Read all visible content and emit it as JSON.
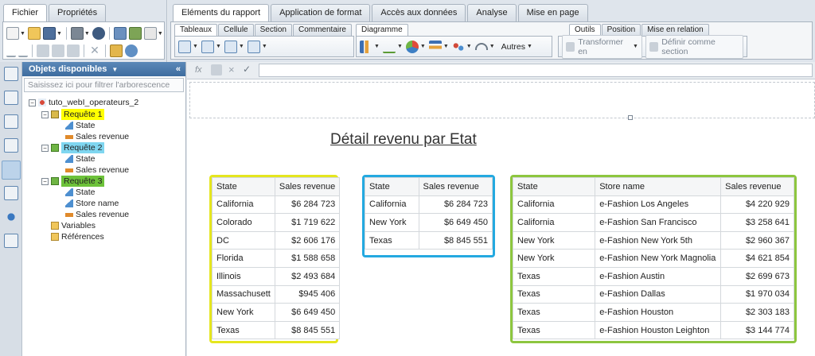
{
  "top_left_tabs": [
    "Fichier",
    "Propriétés"
  ],
  "ribbon_tabs": [
    "Eléments du rapport",
    "Application de format",
    "Accès aux données",
    "Analyse",
    "Mise en page"
  ],
  "ribbon": {
    "group1_tabs": [
      "Tableaux",
      "Cellule",
      "Section",
      "Commentaire"
    ],
    "group2_tabs": [
      "Diagramme"
    ],
    "group3_tabs": [
      "Outils",
      "Position",
      "Mise en relation"
    ],
    "autres_label": "Autres",
    "transformer_label": "Transformer en",
    "definir_label": "Définir comme section"
  },
  "objects_panel": {
    "title": "Objets disponibles",
    "filter_placeholder": "Saisissez ici pour filtrer l'arborescence",
    "root": "tuto_webI_operateurs_2",
    "query1": {
      "label": "Requête 1",
      "color": "#ffff00",
      "items": [
        "State",
        "Sales revenue"
      ]
    },
    "query2": {
      "label": "Requête 2",
      "color": "#7fd6f0",
      "items": [
        "State",
        "Sales revenue"
      ]
    },
    "query3": {
      "label": "Requête 3",
      "color": "#6dc23a",
      "items": [
        "State",
        "Store name",
        "Sales revenue"
      ]
    },
    "variables": "Variables",
    "references": "Références"
  },
  "report": {
    "title": "Détail revenu par Etat",
    "table1": {
      "frame_color": "#e5e61e",
      "headers": [
        "State",
        "Sales revenue"
      ],
      "rows": [
        [
          "California",
          "$6 284 723"
        ],
        [
          "Colorado",
          "$1 719 622"
        ],
        [
          "DC",
          "$2 606 176"
        ],
        [
          "Florida",
          "$1 588 658"
        ],
        [
          "Illinois",
          "$2 493 684"
        ],
        [
          "Massachusett",
          "$945 406"
        ],
        [
          "New York",
          "$6 649 450"
        ],
        [
          "Texas",
          "$8 845 551"
        ]
      ]
    },
    "table2": {
      "frame_color": "#24a9e0",
      "headers": [
        "State",
        "Sales revenue"
      ],
      "rows": [
        [
          "California",
          "$6 284 723"
        ],
        [
          "New York",
          "$6 649 450"
        ],
        [
          "Texas",
          "$8 845 551"
        ]
      ]
    },
    "table3": {
      "frame_color": "#8dc63f",
      "headers": [
        "State",
        "Store name",
        "Sales revenue"
      ],
      "rows": [
        [
          "California",
          "e-Fashion Los Angeles",
          "$4 220 929"
        ],
        [
          "California",
          "e-Fashion San Francisco",
          "$3 258 641"
        ],
        [
          "New York",
          "e-Fashion New York 5th",
          "$2 960 367"
        ],
        [
          "New York",
          "e-Fashion New York Magnolia",
          "$4 621 854"
        ],
        [
          "Texas",
          "e-Fashion Austin",
          "$2 699 673"
        ],
        [
          "Texas",
          "e-Fashion Dallas",
          "$1 970 034"
        ],
        [
          "Texas",
          "e-Fashion Houston",
          "$2 303 183"
        ],
        [
          "Texas",
          "e-Fashion Houston Leighton",
          "$3 144 774"
        ]
      ]
    }
  }
}
